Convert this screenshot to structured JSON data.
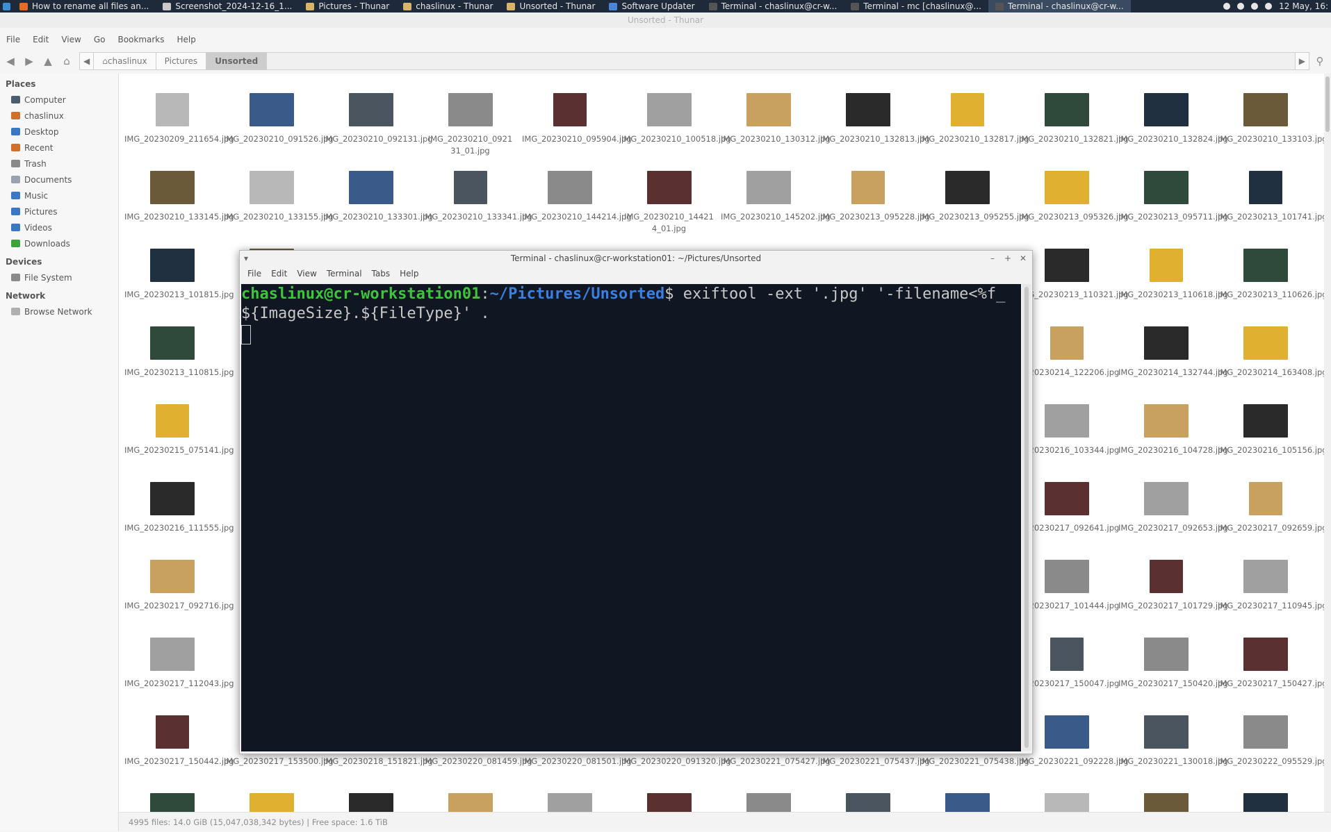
{
  "taskbar": {
    "tasks": [
      {
        "label": "How to rename all files an...",
        "color": "#e66b21"
      },
      {
        "label": "Screenshot_2024-12-16_1...",
        "color": "#c9c9c9"
      },
      {
        "label": "Pictures - Thunar",
        "color": "#d8b46a"
      },
      {
        "label": "chaslinux - Thunar",
        "color": "#d8b46a"
      },
      {
        "label": "Unsorted - Thunar",
        "color": "#d8b46a"
      },
      {
        "label": "Software Updater",
        "color": "#4a86d8"
      },
      {
        "label": "Terminal - chaslinux@cr-w...",
        "color": "#555555"
      },
      {
        "label": "Terminal - mc [chaslinux@...",
        "color": "#555555"
      },
      {
        "label": "Terminal - chaslinux@cr-w...",
        "color": "#555555"
      }
    ],
    "clock": "12 May, 16:"
  },
  "window": {
    "title": "Unsorted - Thunar"
  },
  "menu": [
    "File",
    "Edit",
    "View",
    "Go",
    "Bookmarks",
    "Help"
  ],
  "breadcrumbs": [
    "chaslinux",
    "Pictures",
    "Unsorted"
  ],
  "sidebar": {
    "places_label": "Places",
    "places": [
      {
        "label": "Computer",
        "icon": "computer-icon",
        "color": "#4d5d6e"
      },
      {
        "label": "chaslinux",
        "icon": "home-icon",
        "color": "#d0702a"
      },
      {
        "label": "Desktop",
        "icon": "desktop-icon",
        "color": "#3a78c3"
      },
      {
        "label": "Recent",
        "icon": "recent-icon",
        "color": "#d0702a"
      },
      {
        "label": "Trash",
        "icon": "trash-icon",
        "color": "#8a8a8a"
      },
      {
        "label": "Documents",
        "icon": "documents-icon",
        "color": "#9aa3ad"
      },
      {
        "label": "Music",
        "icon": "music-icon",
        "color": "#3a78c3"
      },
      {
        "label": "Pictures",
        "icon": "pictures-icon",
        "color": "#3a78c3"
      },
      {
        "label": "Videos",
        "icon": "videos-icon",
        "color": "#3a78c3"
      },
      {
        "label": "Downloads",
        "icon": "downloads-icon",
        "color": "#3da33d"
      }
    ],
    "devices_label": "Devices",
    "devices": [
      {
        "label": "File System",
        "icon": "drive-icon",
        "color": "#8a8a8a"
      }
    ],
    "network_label": "Network",
    "network": [
      {
        "label": "Browse Network",
        "icon": "network-icon",
        "color": "#b0b0b0"
      }
    ]
  },
  "files": [
    [
      "IMG_20230209_211654.jpg",
      "IMG_20230210_091526.jpg",
      "IMG_20230210_092131.jpg",
      "IMG_20230210_0921 31_01.jpg",
      "IMG_20230210_095904.jpg",
      "IMG_20230210_100518.jpg",
      "IMG_20230210_130312.jpg",
      "IMG_20230210_132813.jpg",
      "IMG_20230210_132817.jpg",
      "IMG_20230210_132821.jpg",
      "IMG_20230210_132824.jpg",
      "IMG_20230210_133103.jpg"
    ],
    [
      "IMG_20230210_133145.jpg",
      "IMG_20230210_133155.jpg",
      "IMG_20230210_133301.jpg",
      "IMG_20230210_133341.jpg",
      "IMG_20230210_144214.jpg",
      "IMG_20230210_14421 4_01.jpg",
      "IMG_20230210_145202.jpg",
      "IMG_20230213_095228.jpg",
      "IMG_20230213_095255.jpg",
      "IMG_20230213_095326.jpg",
      "IMG_20230213_095711.jpg",
      "IMG_20230213_101741.jpg"
    ],
    [
      "IMG_20230213_101815.jpg",
      "IMG",
      "",
      "",
      "",
      "",
      "",
      "",
      "",
      "IMG_20230213_110321.jpg",
      "IMG_20230213_110618.jpg",
      "IMG_20230213_110626.jpg"
    ],
    [
      "IMG_20230213_110815.jpg",
      "IMG",
      "",
      "",
      "",
      "",
      "",
      "",
      "",
      "G_20230214_122206.jpg",
      "IMG_20230214_132744.jpg",
      "IMG_20230214_163408.jpg"
    ],
    [
      "IMG_20230215_075141.jpg",
      "IMG",
      "",
      "",
      "",
      "",
      "",
      "",
      "",
      "G_20230216_103344.jpg",
      "IMG_20230216_104728.jpg",
      "IMG_20230216_105156.jpg"
    ],
    [
      "IMG_20230216_111555.jpg",
      "IMG",
      "",
      "",
      "",
      "",
      "",
      "",
      "",
      "G_20230217_092641.jpg",
      "IMG_20230217_092653.jpg",
      "IMG_20230217_092659.jpg"
    ],
    [
      "IMG_20230217_092716.jpg",
      "IMG",
      "",
      "",
      "",
      "",
      "",
      "",
      "",
      "G_20230217_101444.jpg",
      "IMG_20230217_101729.jpg",
      "IMG_20230217_110945.jpg"
    ],
    [
      "IMG_20230217_112043.jpg",
      "IMG",
      "",
      "",
      "",
      "",
      "",
      "",
      "",
      "G_20230217_150047.jpg",
      "IMG_20230217_150420.jpg",
      "IMG_20230217_150427.jpg"
    ],
    [
      "IMG_20230217_150442.jpg",
      "IMG_20230217_153500.jpg",
      "IMG_20230218_151821.jpg",
      "IMG_20230220_081459.jpg",
      "IMG_20230220_081501.jpg",
      "IMG_20230220_091320.jpg",
      "IMG_20230221_075427.jpg",
      "IMG_20230221_075437.jpg",
      "IMG_20230221_075438.jpg",
      "IMG_20230221_092228.jpg",
      "IMG_20230221_130018.jpg",
      "IMG_20230222_095529.jpg"
    ]
  ],
  "status": "4995 files: 14.0 GiB (15,047,038,342 bytes)  |  Free space: 1.6 TiB",
  "terminal": {
    "title": "Terminal - chaslinux@cr-workstation01: ~/Pictures/Unsorted",
    "menu": [
      "File",
      "Edit",
      "View",
      "Terminal",
      "Tabs",
      "Help"
    ],
    "prompt_user": "chaslinux@cr-workstation01",
    "prompt_sep": ":",
    "prompt_path": "~/Pictures/Unsorted",
    "prompt_end": "$ ",
    "command": "exiftool -ext '.jpg' '-filename<%f_${ImageSize}.${FileType}' ."
  },
  "colors": {
    "terminal_bg": "#111722",
    "prompt_user": "#3ec53e",
    "prompt_path": "#3b7fe0",
    "thumb_palette": [
      "#b8b8b8",
      "#2a2a2a",
      "#4a5560",
      "#2f4a3a",
      "#5a3030",
      "#6b5a3a",
      "#c8a060",
      "#3a5a8a",
      "#e0b030",
      "#8a8a8a",
      "#203040",
      "#a0a0a0"
    ]
  }
}
